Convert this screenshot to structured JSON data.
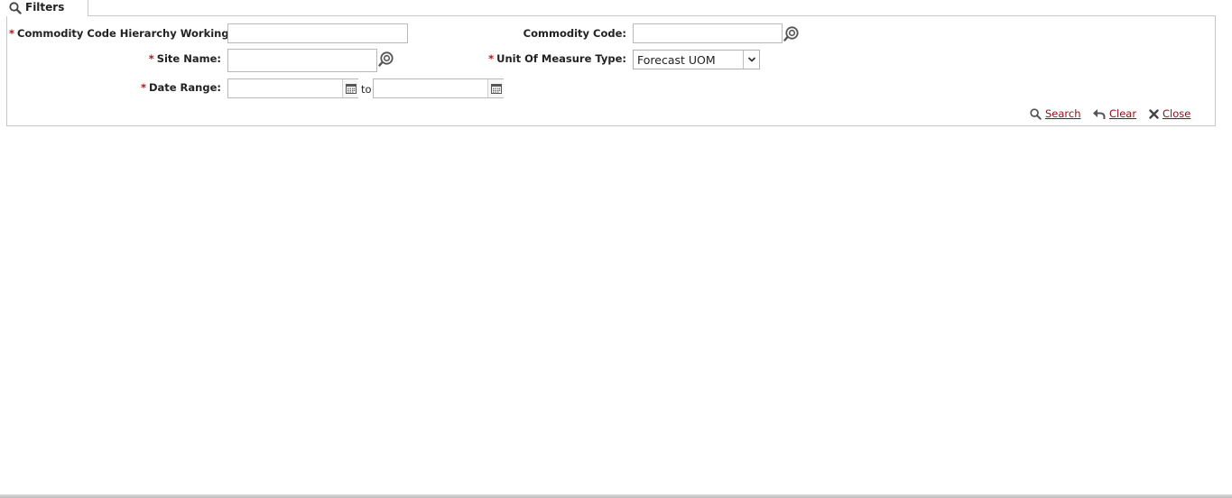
{
  "filters_tab": {
    "label": "Filters",
    "icon": "search-icon"
  },
  "form": {
    "commodity_hierarchy": {
      "label": "Commodity Code Hierarchy Working Level:",
      "required": "*",
      "value": ""
    },
    "commodity_code": {
      "label": "Commodity Code:",
      "value": "",
      "icon": "lookup-icon"
    },
    "site_name": {
      "label": "Site Name:",
      "required": "*",
      "value": "",
      "icon": "lookup-icon"
    },
    "uom_type": {
      "label": "Unit Of Measure Type:",
      "required": "*",
      "selected": "Forecast UOM"
    },
    "date_range": {
      "label": "Date Range:",
      "required": "*",
      "from": "",
      "to": "",
      "separator": "to",
      "icon": "calendar-icon"
    }
  },
  "actions": {
    "search": {
      "label": "Search",
      "icon": "search-icon"
    },
    "clear": {
      "label": "Clear",
      "icon": "undo-icon"
    },
    "close": {
      "label": "Close",
      "icon": "close-icon"
    }
  },
  "colors": {
    "required": "#b0151c",
    "link": "#8b0e16",
    "border": "#c8c8c8"
  }
}
